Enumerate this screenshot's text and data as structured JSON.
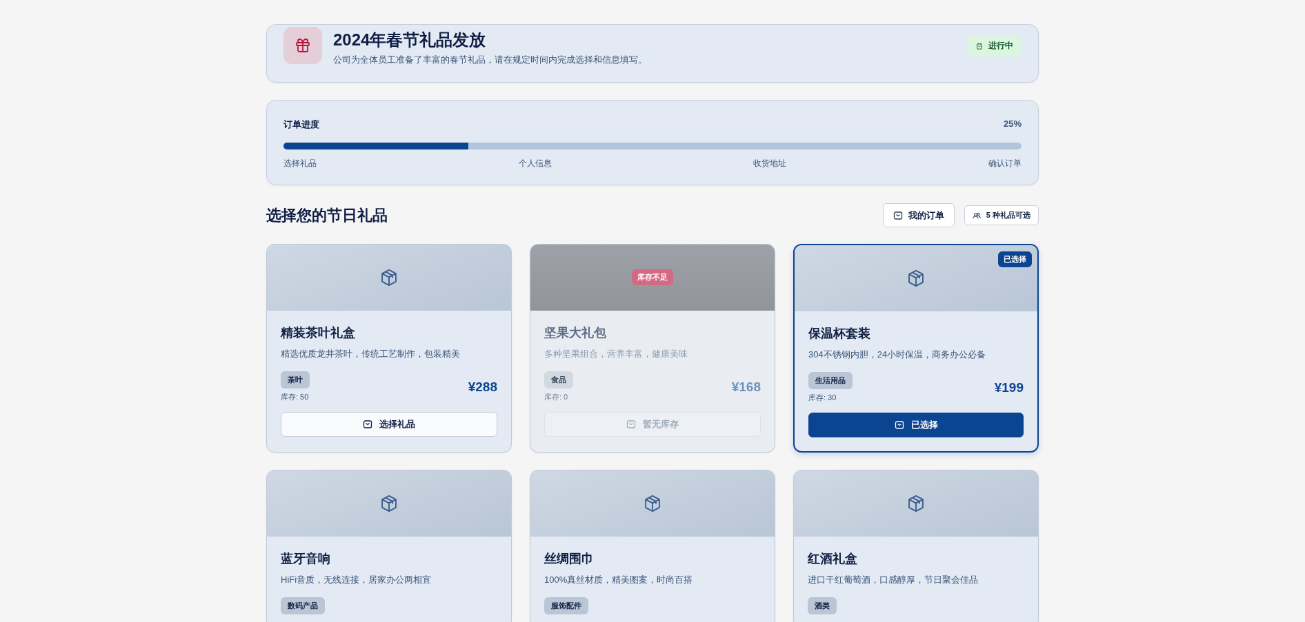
{
  "header": {
    "title": "2024年春节礼品发放",
    "subtitle": "公司为全体员工准备了丰富的春节礼品，请在规定时间内完成选择和信息填写。",
    "status": "进行中"
  },
  "progress": {
    "label": "订单进度",
    "percent": "25%",
    "level": 0.25,
    "steps": [
      "选择礼品",
      "个人信息",
      "收货地址",
      "确认订单"
    ]
  },
  "section": {
    "title": "选择您的节日礼品",
    "orders_button": "我的订单",
    "count_button": "5 种礼品可选"
  },
  "gifts": [
    {
      "name": "精装茶叶礼盒",
      "desc": "精选优质龙井茶叶，传统工艺制作，包装精美",
      "tag": "茶叶",
      "price": "¥288",
      "stock": "库存: 50",
      "button": "选择礼品",
      "selected": false,
      "disabled": false
    },
    {
      "name": "坚果大礼包",
      "desc": "多种坚果组合，营养丰富，健康美味",
      "tag": "食品",
      "price": "¥168",
      "stock": "库存: 0",
      "button": "暂无库存",
      "badge": "库存不足",
      "selected": false,
      "disabled": true
    },
    {
      "name": "保温杯套装",
      "desc": "304不锈钢内胆，24小时保温，商务办公必备",
      "tag": "生活用品",
      "price": "¥199",
      "stock": "库存: 30",
      "button": "已选择",
      "badge": "已选择",
      "selected": true,
      "disabled": false
    },
    {
      "name": "蓝牙音响",
      "desc": "HiFi音质，无线连接，居家办公两相宜",
      "tag": "数码产品",
      "selected": false,
      "disabled": false
    },
    {
      "name": "丝绸围巾",
      "desc": "100%真丝材质，精美图案，时尚百搭",
      "tag": "服饰配件",
      "selected": false,
      "disabled": false
    },
    {
      "name": "红酒礼盒",
      "desc": "进口干红葡萄酒，口感醇厚，节日聚会佳品",
      "tag": "酒类",
      "selected": false,
      "disabled": false
    }
  ]
}
